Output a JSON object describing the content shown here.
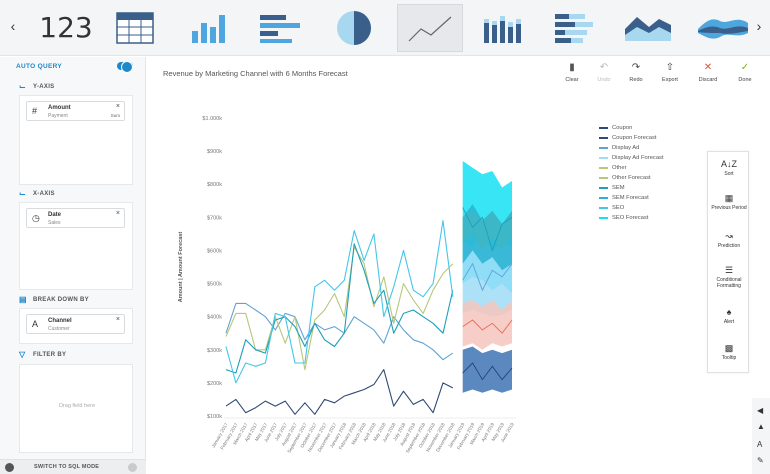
{
  "nav": {
    "prev_icon": "chevron-left-icon",
    "next_icon": "chevron-right-icon"
  },
  "chart_types": [
    {
      "name": "number",
      "label": "123"
    },
    {
      "name": "table-icon"
    },
    {
      "name": "bar-chart-icon"
    },
    {
      "name": "horizontal-bar-icon"
    },
    {
      "name": "pie-chart-icon"
    },
    {
      "name": "line-chart-icon",
      "selected": true
    },
    {
      "name": "stacked-bar-icon"
    },
    {
      "name": "stacked-horizontal-bar-icon"
    },
    {
      "name": "area-chart-icon"
    },
    {
      "name": "stream-chart-icon"
    }
  ],
  "left_panel": {
    "auto_query_label": "AUTO QUERY",
    "auto_query_on": true,
    "y_axis": {
      "title": "Y-AXIS",
      "field_name": "Amount",
      "field_table": "Payment",
      "aggregation": "Sum"
    },
    "x_axis": {
      "title": "X-AXIS",
      "field_name": "Date",
      "field_table": "Sales"
    },
    "break_down_by": {
      "title": "BREAK DOWN BY",
      "field_name": "Channel",
      "field_table": "Customer"
    },
    "filter_by": {
      "title": "FILTER BY",
      "placeholder": "Drag field here"
    },
    "sql_button": "SWITCH TO SQL MODE"
  },
  "toolbar": {
    "clear": "Clear",
    "undo": "Undo",
    "redo": "Redo",
    "export": "Export",
    "discard": "Discard",
    "done": "Done",
    "accent_discard": "#e74c3c",
    "accent_done": "#7cb518"
  },
  "float_menu": {
    "sort": "Sort",
    "previous_period": "Previous Period",
    "prediction": "Prediction",
    "conditional_formatting": "Conditional Formatting",
    "alert": "Alert",
    "tooltip": "Tooltip"
  },
  "chart_data": {
    "type": "line",
    "title": "Revenue by Marketing Channel with 6 Months Forecast",
    "ylabel": "Amount | Amount Forecast",
    "xlabel": "",
    "yticks": [
      "$1.000k",
      "$900k",
      "$800k",
      "$700k",
      "$600k",
      "$500k",
      "$400k",
      "$300k",
      "$200k",
      "$100k"
    ],
    "ylim": [
      100,
      1000
    ],
    "x": [
      "January 2017",
      "February 2017",
      "March 2017",
      "April 2017",
      "May 2017",
      "June 2017",
      "July 2017",
      "August 2017",
      "September 2017",
      "October 2017",
      "November 2017",
      "December 2017",
      "January 2018",
      "February 2018",
      "March 2018",
      "April 2018",
      "May 2018",
      "June 2018",
      "July 2018",
      "August 2018",
      "September 2018",
      "October 2018",
      "November 2018",
      "December 2018"
    ],
    "forecast_x": [
      "January 2019",
      "February 2019",
      "March 2019",
      "April 2019",
      "May 2019",
      "June 2019"
    ],
    "legend_position": "right",
    "series": [
      {
        "name": "Coupon",
        "color": "#2f4a75",
        "values": [
          130,
          150,
          110,
          125,
          145,
          130,
          145,
          105,
          140,
          105,
          150,
          140,
          160,
          170,
          180,
          195,
          240,
          130,
          175,
          135,
          150,
          110,
          200,
          185
        ]
      },
      {
        "name": "Display Ad",
        "color": "#5fa3d6",
        "values": [
          350,
          440,
          440,
          420,
          400,
          360,
          410,
          400,
          330,
          380,
          360,
          370,
          350,
          400,
          380,
          360,
          320,
          400,
          360,
          330,
          320,
          300,
          270,
          290
        ]
      },
      {
        "name": "Other",
        "color": "#b7c77a",
        "values": [
          340,
          410,
          410,
          300,
          300,
          400,
          320,
          400,
          240,
          390,
          420,
          470,
          400,
          610,
          560,
          430,
          520,
          380,
          500,
          450,
          410,
          480,
          530,
          560
        ]
      },
      {
        "name": "SEM",
        "color": "#1f9fb8",
        "values": [
          240,
          230,
          330,
          300,
          290,
          390,
          400,
          370,
          310,
          380,
          330,
          310,
          350,
          620,
          540,
          440,
          480,
          350,
          410,
          420,
          400,
          380,
          350,
          480
        ]
      },
      {
        "name": "SEO",
        "color": "#45c6e8",
        "values": [
          310,
          200,
          260,
          250,
          260,
          410,
          400,
          260,
          260,
          490,
          510,
          480,
          510,
          660,
          570,
          650,
          400,
          490,
          600,
          480,
          460,
          500,
          690,
          460
        ]
      }
    ],
    "forecast_bands": [
      {
        "name": "SEO Forecast",
        "color": "#15e0f2",
        "low": [
          500,
          520,
          510,
          480,
          500,
          470
        ],
        "high": [
          870,
          850,
          830,
          840,
          790,
          810
        ],
        "mid": [
          700,
          730,
          680,
          710,
          660,
          700
        ]
      },
      {
        "name": "Display Ad Forecast",
        "color": "#9fdcf6",
        "low": [
          410,
          420,
          410,
          400,
          405,
          420
        ],
        "high": [
          630,
          610,
          650,
          600,
          620,
          610
        ],
        "mid": [
          540,
          560,
          500,
          550,
          530,
          560
        ]
      },
      {
        "name": "Other Forecast",
        "color": "#a9cf7d",
        "low": [
          620,
          650,
          600,
          640,
          600,
          650
        ],
        "high": [
          700,
          720,
          690,
          720,
          680,
          720
        ],
        "mid": [
          660,
          690,
          640,
          680,
          650,
          690
        ]
      },
      {
        "name": "SEM Forecast",
        "color": "#2ab3d1",
        "low": [
          560,
          600,
          560,
          580,
          540,
          560
        ],
        "high": [
          700,
          740,
          690,
          720,
          680,
          720
        ],
        "mid": [
          630,
          680,
          610,
          650,
          620,
          660
        ]
      },
      {
        "name": "Coupon Forecast",
        "color": "#f6c6bd",
        "low": [
          310,
          320,
          300,
          320,
          310,
          320
        ],
        "high": [
          440,
          450,
          430,
          450,
          420,
          450
        ],
        "mid": [
          370,
          390,
          360,
          380,
          360,
          390
        ]
      },
      {
        "name": "Coupon Forecast",
        "color": "#3f73b5",
        "low": [
          170,
          180,
          170,
          180,
          170,
          180
        ],
        "high": [
          300,
          310,
          290,
          300,
          290,
          300
        ],
        "mid": [
          230,
          240,
          220,
          250,
          220,
          240
        ]
      }
    ],
    "forecast_lines": [
      {
        "color": "#1f9fb8",
        "values": [
          730,
          670,
          700,
          600,
          680,
          700
        ]
      },
      {
        "color": "#5fa3d6",
        "values": [
          510,
          560,
          480,
          540,
          520,
          560
        ]
      },
      {
        "color": "#e96a58",
        "values": [
          370,
          390,
          360,
          380,
          350,
          390
        ]
      },
      {
        "color": "#25447a",
        "values": [
          230,
          260,
          210,
          250,
          210,
          245
        ]
      }
    ],
    "legend": [
      {
        "label": "Coupon",
        "color": "#2f4a75"
      },
      {
        "label": "Coupon Forecast",
        "color": "#2f4a75"
      },
      {
        "label": "Display Ad",
        "color": "#5fa3d6"
      },
      {
        "label": "Display Ad Forecast",
        "color": "#9fdcf6"
      },
      {
        "label": "Other",
        "color": "#b7c77a"
      },
      {
        "label": "Other Forecast",
        "color": "#b7c77a"
      },
      {
        "label": "SEM",
        "color": "#1f9fb8"
      },
      {
        "label": "SEM Forecast",
        "color": "#2ab3d1"
      },
      {
        "label": "SEO",
        "color": "#45c6e8"
      },
      {
        "label": "SEO Forecast",
        "color": "#15e0f2"
      }
    ]
  }
}
